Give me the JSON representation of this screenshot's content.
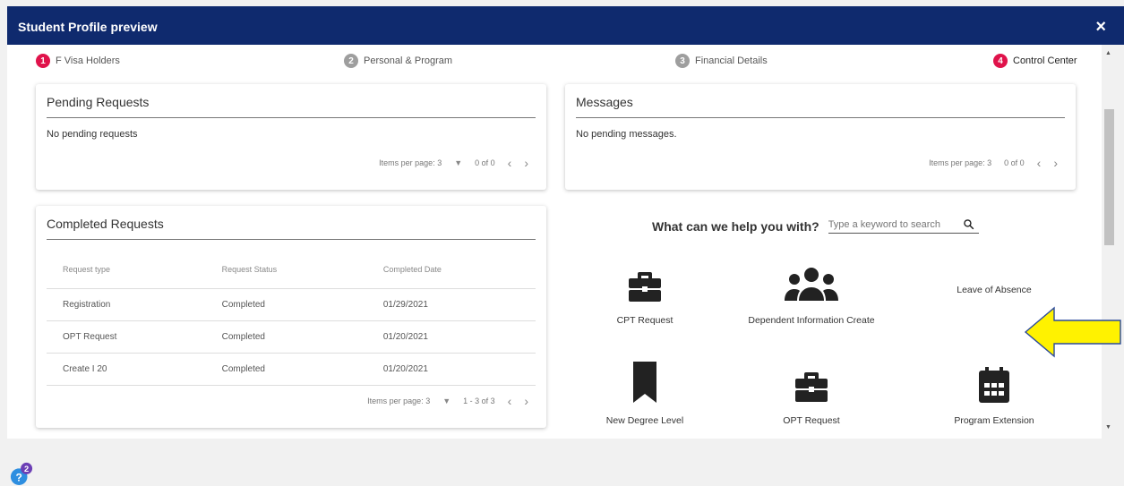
{
  "header": {
    "title": "Student Profile preview",
    "close_label": "×"
  },
  "steps": [
    {
      "num": "1",
      "label": "F Visa Holders"
    },
    {
      "num": "2",
      "label": "Personal & Program"
    },
    {
      "num": "3",
      "label": "Financial Details"
    },
    {
      "num": "4",
      "label": "Control Center"
    }
  ],
  "pending": {
    "title": "Pending Requests",
    "empty": "No pending requests",
    "items_per_page": "Items per page: 3",
    "range": "0 of 0"
  },
  "messages": {
    "title": "Messages",
    "empty": "No pending messages.",
    "items_per_page": "Items per page: 3",
    "range": "0 of 0"
  },
  "completed": {
    "title": "Completed Requests",
    "columns": [
      "Request type",
      "Request Status",
      "Completed Date"
    ],
    "rows": [
      [
        "Registration",
        "Completed",
        "01/29/2021"
      ],
      [
        "OPT Request",
        "Completed",
        "01/20/2021"
      ],
      [
        "Create I 20",
        "Completed",
        "01/20/2021"
      ]
    ],
    "items_per_page": "Items per page: 3",
    "range": "1 - 3 of 3"
  },
  "help": {
    "question": "What can we help you with?",
    "placeholder": "Type a keyword to search"
  },
  "tiles": [
    {
      "label": "CPT Request",
      "icon": "briefcase-icon"
    },
    {
      "label": "Dependent Information Create",
      "icon": "users-icon"
    },
    {
      "label": "Leave of Absence",
      "icon": ""
    },
    {
      "label": "New Degree Level",
      "icon": "bookmark-icon"
    },
    {
      "label": "OPT Request",
      "icon": "briefcase-icon"
    },
    {
      "label": "Program Extension",
      "icon": "calendar-icon"
    }
  ],
  "fab": {
    "badge": "2",
    "glyph": "?"
  },
  "colors": {
    "header": "#0f2a6e",
    "active_step": "#e0134b",
    "arrow": "#fff200"
  }
}
